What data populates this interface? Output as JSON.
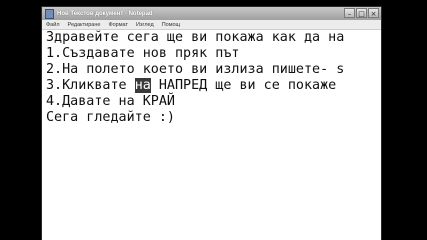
{
  "window": {
    "title": "Нов Текстов документ - Notepad",
    "minimize_glyph": "–",
    "maximize_glyph": "□",
    "close_glyph": "×"
  },
  "menu": {
    "items": [
      "Файл",
      "Редактиране",
      "Формат",
      "Изглед",
      "Помощ"
    ]
  },
  "editor": {
    "lines": [
      "Здравейте сега ще ви покажа как да на",
      "1.Създавате нов пряк път",
      "2.На полето което ви излиза пишете- s",
      "3.Кликвате на НАПРЕД ще ви се покаже",
      "4.Давате на КРАЙ",
      "Сега гледайте :)"
    ],
    "line3_parts": {
      "before": "3.Кликвате ",
      "selected": "на",
      "after": " НАПРЕД ще ви се покаже"
    }
  }
}
